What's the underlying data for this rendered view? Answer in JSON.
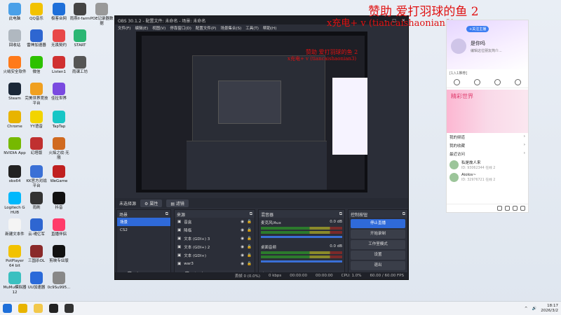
{
  "desktop_icons": [
    {
      "label": "此电脑",
      "color": "#4aa0e8"
    },
    {
      "label": "QQ音乐",
      "color": "#f2c200"
    },
    {
      "label": "极客台网",
      "color": "#1e6fd9"
    },
    {
      "label": "雨燕Il·farm",
      "color": "#444"
    },
    {
      "label": "POE记录器数据",
      "color": "#999"
    },
    {
      "label": "回收站",
      "color": "#b0b8c0"
    },
    {
      "label": "雷神加速器",
      "color": "#2e66d1"
    },
    {
      "label": "无畏契约",
      "color": "#e84848"
    },
    {
      "label": "START",
      "color": "#2bb673"
    },
    {
      "label": "火绒安全软件",
      "color": "#ff7a1a"
    },
    {
      "label": "微信",
      "color": "#2dc100"
    },
    {
      "label": "Listen1",
      "color": "#d03030"
    },
    {
      "label": "雨课工坊",
      "color": "#555"
    },
    {
      "label": "Steam",
      "color": "#1b2838"
    },
    {
      "label": "完美世界竞技平台",
      "color": "#f0a020"
    },
    {
      "label": "佳拉世界",
      "color": "#7a4ae0"
    },
    {
      "label": "Chrome",
      "color": "#e8b400"
    },
    {
      "label": "YY语音",
      "color": "#f2d400"
    },
    {
      "label": "TapTap",
      "color": "#17c6c6"
    },
    {
      "label": "NVIDIA App",
      "color": "#76b900"
    },
    {
      "label": "幻塔版",
      "color": "#c03030"
    },
    {
      "label": "火焰之纹·无限",
      "color": "#d06a20"
    },
    {
      "label": "obs64",
      "color": "#222"
    },
    {
      "label": "KK官方对战平台",
      "color": "#3a70d6"
    },
    {
      "label": "WeGame",
      "color": "#c02020"
    },
    {
      "label": "Logitech G HUB",
      "color": "#00b8fc"
    },
    {
      "label": "雨刷",
      "color": "#333"
    },
    {
      "label": "抖音",
      "color": "#111"
    },
    {
      "label": "新建文本件",
      "color": "#f4f4f4"
    },
    {
      "label": "云·魂亿军",
      "color": "#2e66d1"
    },
    {
      "label": "直播伴侣",
      "color": "#ff3c6a"
    },
    {
      "label": "PotPlayer 64 bit",
      "color": "#f2c200"
    },
    {
      "label": "三国杀OL",
      "color": "#8a2a2a"
    },
    {
      "label": "剪映专业版",
      "color": "#111"
    },
    {
      "label": "MuMu模拟器12",
      "color": "#3ac0c0"
    },
    {
      "label": "UU加速器",
      "color": "#2a6ad9"
    },
    {
      "label": "0c9Su995...",
      "color": "#888"
    }
  ],
  "obs": {
    "title": "OBS 30.1.2 - 配置文件: 未命名 - 场景: 未命名",
    "menu": [
      "文件(F)",
      "编辑(E)",
      "视图(V)",
      "停靠窗口(D)",
      "配置文件(P)",
      "场景集合(S)",
      "工具(T)",
      "帮助(H)"
    ],
    "no_source_label": "未选择源",
    "toolbar": {
      "properties": "属性",
      "filters": "滤镜"
    },
    "scenes_header": "场景",
    "scenes": [
      {
        "name": "场景",
        "selected": true
      },
      {
        "name": "CS2",
        "selected": false
      }
    ],
    "sources_header": "来源",
    "sources": [
      "音盒",
      "降临",
      "文本 (GDI+) 3",
      "文本 (GDI+) 2",
      "文本 (GDI+)",
      "war3"
    ],
    "mixer_header": "混音器",
    "mixer": [
      {
        "name": "麦克风/Aux",
        "db": "0.0 dB"
      },
      {
        "name": "桌面音频",
        "db": "0.0 dB"
      }
    ],
    "controls_header": "控制按钮",
    "controls": [
      {
        "label": "停止直播",
        "active": true
      },
      {
        "label": "开始录制",
        "active": false
      },
      {
        "label": "工作室模式",
        "active": false
      },
      {
        "label": "设置",
        "active": false
      },
      {
        "label": "退出",
        "active": false
      }
    ],
    "controls_tabs": [
      "控制按钮",
      "转场动画"
    ],
    "status": {
      "dropped": "丢帧 0 (0.0%)",
      "kbps": "0 kbps",
      "stream_time": "00:00:00",
      "rec_time": "00:00:00",
      "cpu": "CPU: 1.0%",
      "fps": "60.00 / 60.00 FPS"
    }
  },
  "overlay": {
    "big_line": "赞助    爱打羽球的鱼      2",
    "big_sub": "x充电+ v (tiancaishaonian3)",
    "small_line": "赞助    爱打羽球的鱼      2",
    "small_sub": "x充电+ v (tiancaishaonian3)"
  },
  "right_panel": {
    "badge": "+关注主播",
    "name": "是你吗",
    "sign": "编辑这位朋友简介...",
    "level": "[1入1推荐]",
    "banner_title": "精彩世界",
    "menu": [
      "我的频道",
      "我的收藏",
      "最近访问"
    ],
    "recent": [
      {
        "name": "私是故人来",
        "meta": "ID: 93062344  在线 2"
      },
      {
        "name": "Aiolos~",
        "meta": "ID: 32976721  在线 2"
      }
    ]
  },
  "taskbar": {
    "time": "18:17",
    "date": "2026/3/2",
    "apps": [
      {
        "name": "windows-icon",
        "color": "#1e6fd9"
      },
      {
        "name": "chrome-icon",
        "color": "#e8b400"
      },
      {
        "name": "folder-icon",
        "color": "#f2c84b"
      },
      {
        "name": "kk-icon",
        "color": "#222"
      },
      {
        "name": "obs-icon",
        "color": "#333"
      }
    ]
  }
}
